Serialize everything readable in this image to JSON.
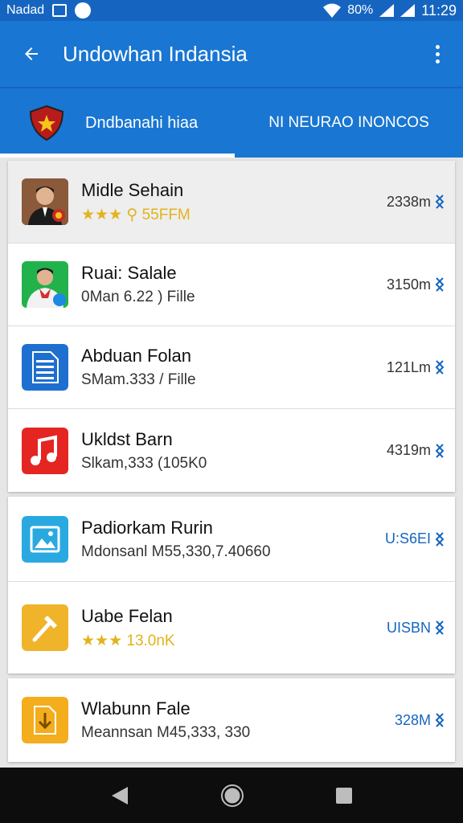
{
  "status_bar": {
    "carrier": "Nadad",
    "battery": "80%",
    "time": "11:29"
  },
  "app_bar": {
    "title": "Undowhan Indansia"
  },
  "tabs": [
    {
      "label": "Dndbanahi hiaa",
      "selected": true
    },
    {
      "label": "NI NEURAO INONCOS",
      "selected": false
    }
  ],
  "items": [
    {
      "title": "Midle Sehain",
      "subtitle": "⚲ 55FFM",
      "stars": "★★★",
      "size": "2338m",
      "icon": "person-photo",
      "selected": true
    },
    {
      "title": "Ruai: Salale",
      "subtitle": "0Man 6.22 ) Fille",
      "size": "3150m",
      "icon": "person-photo-green"
    },
    {
      "title": "Abduan Folan",
      "subtitle": "SMam.333 / Fille",
      "size": "121Lm",
      "icon": "document-icon"
    },
    {
      "title": "Ukldst Barn",
      "subtitle": "Slkam,333 (105K0",
      "size": "4319m",
      "icon": "music-note-icon"
    },
    {
      "title": "Padiorkam Rurin",
      "subtitle": "Mdonsanl M55,330,7.40660",
      "size": "U:S6EI",
      "icon": "image-icon"
    },
    {
      "title": "Uabe Felan",
      "subtitle": "13.0nK",
      "stars": "★★★",
      "size": "UISBN",
      "icon": "hammer-icon"
    },
    {
      "title": "Wlabunn Fale",
      "subtitle": "Meannsan M45,333, 330",
      "size": "328M",
      "icon": "download-file-icon"
    }
  ],
  "colors": {
    "primary": "#1976d2",
    "status": "#1565c0",
    "accent_link": "#1565c0",
    "star": "#e3b21d"
  }
}
